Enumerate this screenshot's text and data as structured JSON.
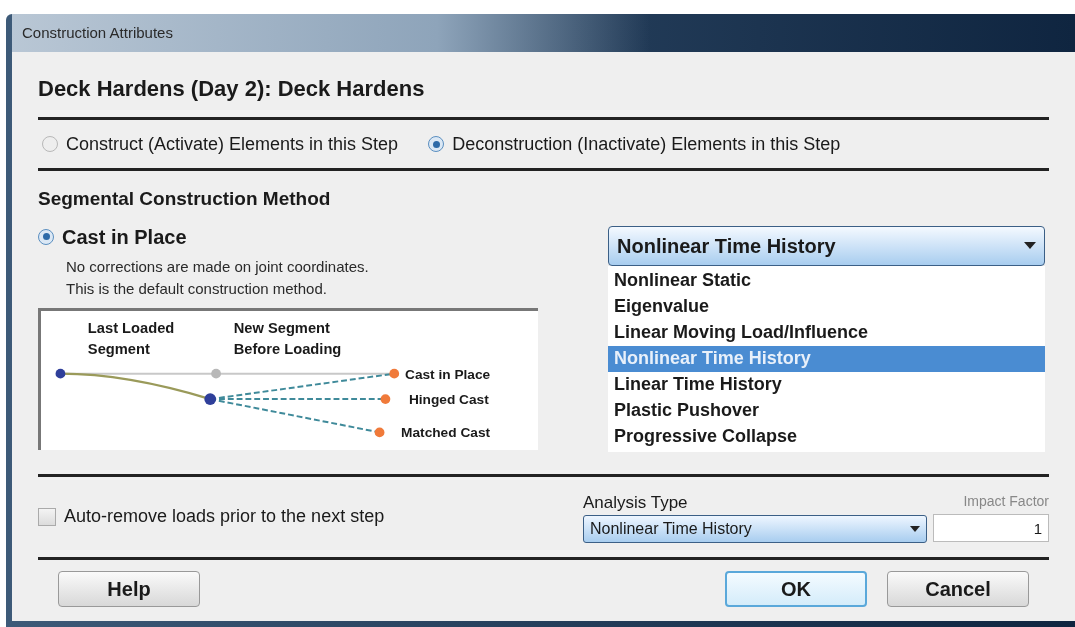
{
  "window": {
    "title": "Construction Attributes"
  },
  "heading": "Deck Hardens (Day 2): Deck Hardens",
  "mode_options": [
    {
      "label": "Construct (Activate) Elements in this Step",
      "selected": false
    },
    {
      "label": "Deconstruction (Inactivate) Elements in this Step",
      "selected": true
    }
  ],
  "section_title": "Segmental Construction Method",
  "method": {
    "label": "Cast in Place",
    "selected": true,
    "description": [
      "No corrections are made on joint coordinates.",
      "This is the default construction method."
    ]
  },
  "diagram": {
    "left_label": [
      "Last Loaded",
      "Segment"
    ],
    "middle_label": [
      "New Segment",
      "Before Loading"
    ],
    "end_labels": [
      "Cast in Place",
      "Hinged Cast",
      "Matched Cast"
    ]
  },
  "analysis_dropdown": {
    "value": "Nonlinear Time History",
    "expanded": true,
    "options": [
      {
        "label": "Nonlinear Static",
        "selected": false
      },
      {
        "label": "Eigenvalue",
        "selected": false
      },
      {
        "label": "Linear Moving Load/Influence",
        "selected": false
      },
      {
        "label": "Nonlinear Time History",
        "selected": true
      },
      {
        "label": "Linear Time History",
        "selected": false
      },
      {
        "label": "Plastic Pushover",
        "selected": false
      },
      {
        "label": "Progressive Collapse",
        "selected": false
      }
    ]
  },
  "auto_remove": {
    "label": "Auto-remove loads prior to the next step",
    "checked": false
  },
  "analysis_type": {
    "label": "Analysis Type",
    "value": "Nonlinear Time History"
  },
  "impact_factor": {
    "label": "Impact Factor",
    "value": "1"
  },
  "buttons": [
    {
      "label": "Help",
      "default": false
    },
    {
      "label": "OK",
      "default": true
    },
    {
      "label": "Cancel",
      "default": false
    }
  ]
}
